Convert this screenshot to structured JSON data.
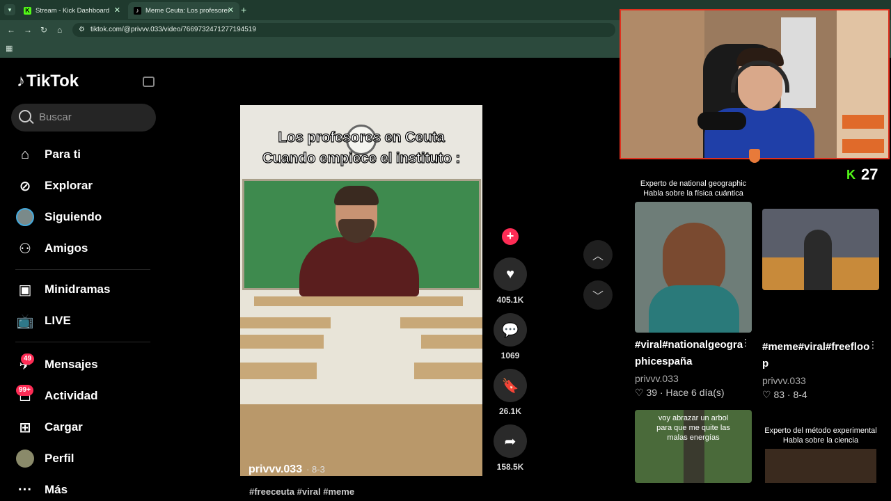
{
  "browser": {
    "tabs": [
      {
        "title": "Stream - Kick Dashboard",
        "fav": "K"
      },
      {
        "title": "Meme Ceuta: Los profesores en",
        "fav": "♪"
      }
    ],
    "url": "tiktok.com/@privvv.033/video/7669732471277194519"
  },
  "tiktok": {
    "logo": "TikTok",
    "search_placeholder": "Buscar",
    "nav": [
      {
        "label": "Para ti",
        "icon": "home-icon"
      },
      {
        "label": "Explorar",
        "icon": "compass-icon"
      },
      {
        "label": "Siguiendo",
        "icon": "following-avatar-icon"
      },
      {
        "label": "Amigos",
        "icon": "friends-icon"
      },
      {
        "label": "Minidramas",
        "icon": "minidramas-icon"
      },
      {
        "label": "LIVE",
        "icon": "live-tv-icon"
      },
      {
        "label": "Mensajes",
        "icon": "messages-icon",
        "badge": "49"
      },
      {
        "label": "Actividad",
        "icon": "activity-icon",
        "badge": "99+"
      },
      {
        "label": "Cargar",
        "icon": "upload-icon"
      },
      {
        "label": "Perfil",
        "icon": "profile-avatar-icon"
      },
      {
        "label": "Más",
        "icon": "more-icon"
      }
    ]
  },
  "video": {
    "caption_line1": "Los profesores en Ceuta",
    "caption_line2": "Cuando empiece el instituto :",
    "author": "privvv.033",
    "date": "· 8-3",
    "tags": "#freeceuta #viral #meme"
  },
  "actions": {
    "likes": "405.1K",
    "comments": "1069",
    "saves": "26.1K",
    "shares": "158.5K"
  },
  "stream": {
    "viewer_count": "27",
    "kick_glyph": "K"
  },
  "profile_videos": [
    {
      "thumb_caption": "Experto de national geographic\nHabla sobre la física cuántica",
      "title": "#viral#nationalgeographicespaña",
      "user": "privvv.033",
      "likes": "39",
      "date": "Hace 6 día(s)"
    },
    {
      "thumb_caption": "",
      "title": "#meme#viral#freefloop",
      "user": "privvv.033",
      "likes": "83",
      "date": "8-4"
    },
    {
      "thumb_caption": "voy abrazar un arbol para que me quite las malas energías",
      "title": "",
      "user": "",
      "likes": "",
      "date": ""
    },
    {
      "thumb_caption": "Experto del método experimental\nHabla sobre la ciencia",
      "title": "",
      "user": "",
      "likes": "",
      "date": ""
    }
  ],
  "colors": {
    "accent": "#fe2c55",
    "kick": "#53fc18",
    "chrome": "#2c4a3d"
  }
}
